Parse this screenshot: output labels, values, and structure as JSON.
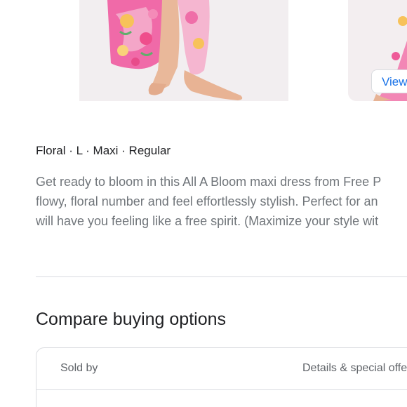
{
  "product": {
    "view_button_label": "View",
    "attributes": "Floral · L · Maxi · Regular",
    "description_lines": [
      "Get ready to bloom in this All A Bloom maxi dress from Free P",
      "flowy, floral number and feel effortlessly stylish. Perfect for an",
      "will have you feeling like a free spirit. (Maximize your style wit"
    ]
  },
  "compare": {
    "title": "Compare buying options",
    "columns": {
      "sold_by": "Sold by",
      "details": "Details & special offe"
    }
  },
  "colors": {
    "accent": "#1a73e8",
    "text_primary": "#202124",
    "text_secondary": "#70757a",
    "border": "#dadce0"
  }
}
